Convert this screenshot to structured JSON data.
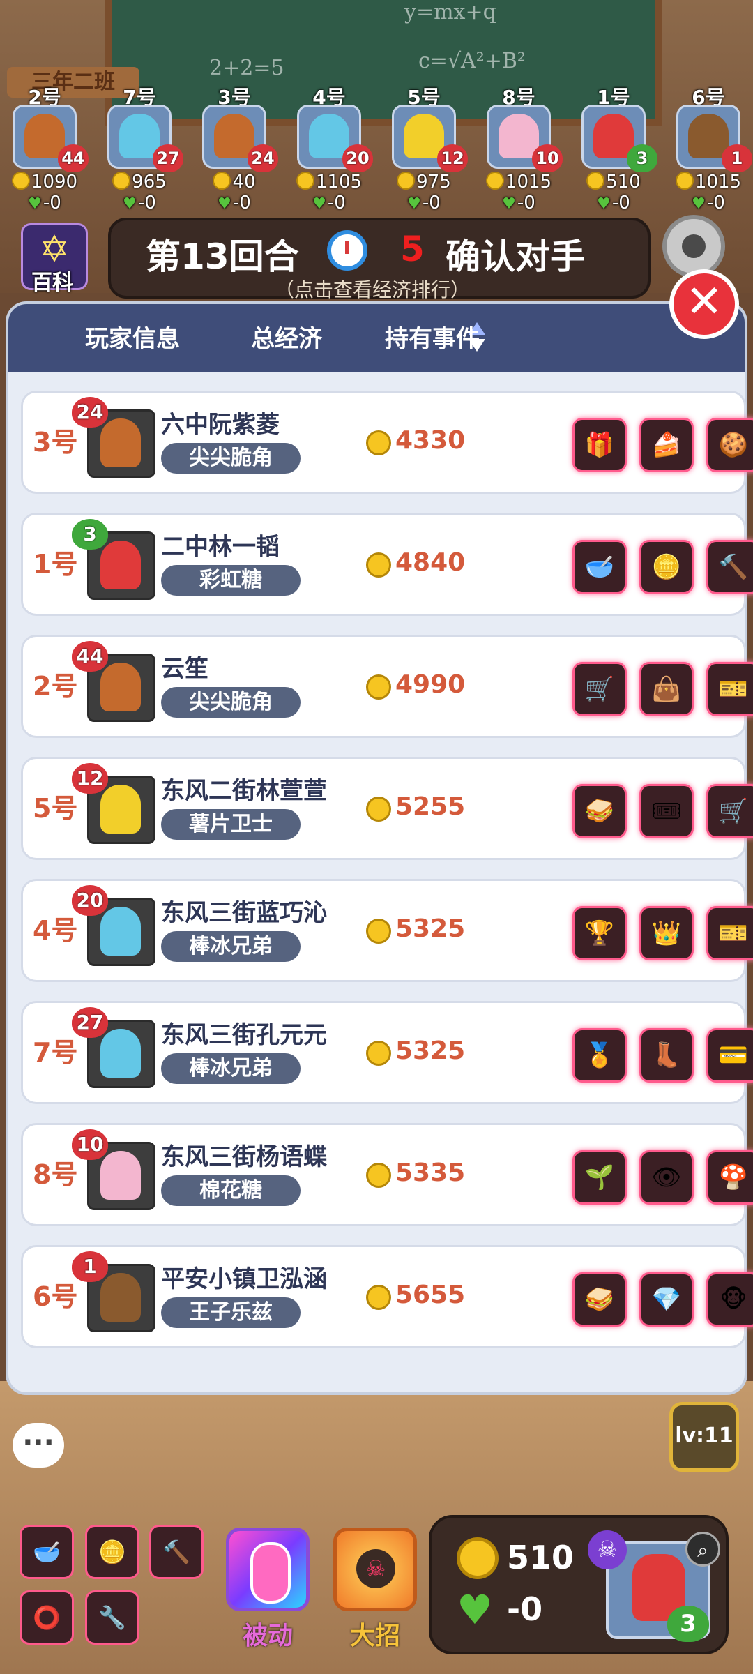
{
  "background": {
    "board_formula_1": "y=mx+q",
    "board_formula_2": "c=√A²+B²",
    "board_formula_3": "2+2=5",
    "class_sign": "三年二班"
  },
  "top_players": [
    {
      "num": "2号",
      "hearts": "44",
      "heart_color": "red",
      "money": "1090",
      "life": "-0",
      "face_color": "#c46a2d"
    },
    {
      "num": "7号",
      "hearts": "27",
      "heart_color": "red",
      "money": "965",
      "life": "-0",
      "face_color": "#63c7e6"
    },
    {
      "num": "3号",
      "hearts": "24",
      "heart_color": "red",
      "money": "40",
      "life": "-0",
      "face_color": "#c46a2d"
    },
    {
      "num": "4号",
      "hearts": "20",
      "heart_color": "red",
      "money": "1105",
      "life": "-0",
      "face_color": "#63c7e6"
    },
    {
      "num": "5号",
      "hearts": "12",
      "heart_color": "red",
      "money": "975",
      "life": "-0",
      "face_color": "#f2cf2a"
    },
    {
      "num": "8号",
      "hearts": "10",
      "heart_color": "red",
      "money": "1015",
      "life": "-0",
      "face_color": "#f3b6cf"
    },
    {
      "num": "1号",
      "hearts": "3",
      "heart_color": "green",
      "money": "510",
      "life": "-0",
      "face_color": "#e03a3a"
    },
    {
      "num": "6号",
      "hearts": "1",
      "heart_color": "red",
      "money": "1015",
      "life": "-0",
      "face_color": "#8a5a2e"
    }
  ],
  "banner": {
    "baike_label": "百科",
    "round": "第13回合",
    "timer": "5",
    "status": "确认对手",
    "hint": "（点击查看经济排行）"
  },
  "table": {
    "col_player": "玩家信息",
    "col_economy": "总经济",
    "col_events": "持有事件",
    "rows": [
      {
        "num": "3号",
        "hearts": "24",
        "heart_color": "red",
        "name": "六中阮紫菱",
        "role": "尖尖脆角",
        "money": "4330",
        "face_color": "#c46a2d",
        "events": [
          "gift-icon",
          "cake-icon",
          "cookie-icon"
        ]
      },
      {
        "num": "1号",
        "hearts": "3",
        "heart_color": "green",
        "name": "二中林一韬",
        "role": "彩虹糖",
        "money": "4840",
        "face_color": "#e03a3a",
        "events": [
          "bowl-icon",
          "chips-icon",
          "hammer-icon"
        ]
      },
      {
        "num": "2号",
        "hearts": "44",
        "heart_color": "red",
        "name": "云笙",
        "role": "尖尖脆角",
        "money": "4990",
        "face_color": "#c46a2d",
        "events": [
          "cart-icon",
          "bag-icon",
          "vip-card-icon"
        ]
      },
      {
        "num": "5号",
        "hearts": "12",
        "heart_color": "red",
        "name": "东风二街林萱萱",
        "role": "薯片卫士",
        "money": "5255",
        "face_color": "#f2cf2a",
        "events": [
          "sandwich-icon",
          "ticket-icon",
          "cart-icon"
        ]
      },
      {
        "num": "4号",
        "hearts": "20",
        "heart_color": "red",
        "name": "东风三街蓝巧沁",
        "role": "棒冰兄弟",
        "money": "5325",
        "face_color": "#63c7e6",
        "events": [
          "podium-icon",
          "crown-icon",
          "vip-card-icon"
        ]
      },
      {
        "num": "7号",
        "hearts": "27",
        "heart_color": "red",
        "name": "东风三街孔元元",
        "role": "棒冰兄弟",
        "money": "5325",
        "face_color": "#63c7e6",
        "events": [
          "medal-icon",
          "boots-icon",
          "vip-pass-icon"
        ]
      },
      {
        "num": "8号",
        "hearts": "10",
        "heart_color": "red",
        "name": "东风三街杨语蝶",
        "role": "棉花糖",
        "money": "5335",
        "face_color": "#f3b6cf",
        "events": [
          "sprout-icon",
          "eye-icon",
          "mushroom-icon"
        ]
      },
      {
        "num": "6号",
        "hearts": "1",
        "heart_color": "red",
        "name": "平安小镇卫泓涵",
        "role": "王子乐兹",
        "money": "5655",
        "face_color": "#8a5a2e",
        "events": [
          "sandwich-icon",
          "gem-coin-icon",
          "monkey-icon"
        ]
      }
    ]
  },
  "bottom": {
    "chat_glyph": "···",
    "level": "lv:11",
    "items": [
      "bowl-icon",
      "chips-icon",
      "hammer-icon",
      "ring-icon",
      "wrench-icon"
    ],
    "passive_label": "被动",
    "ultimate_label": "大招",
    "money": "510",
    "life": "-0",
    "self_hearts": "3"
  },
  "colors": {
    "accent_red": "#d45a3b",
    "header_blue": "#3f4d79",
    "event_border": "#ff5a8c"
  }
}
